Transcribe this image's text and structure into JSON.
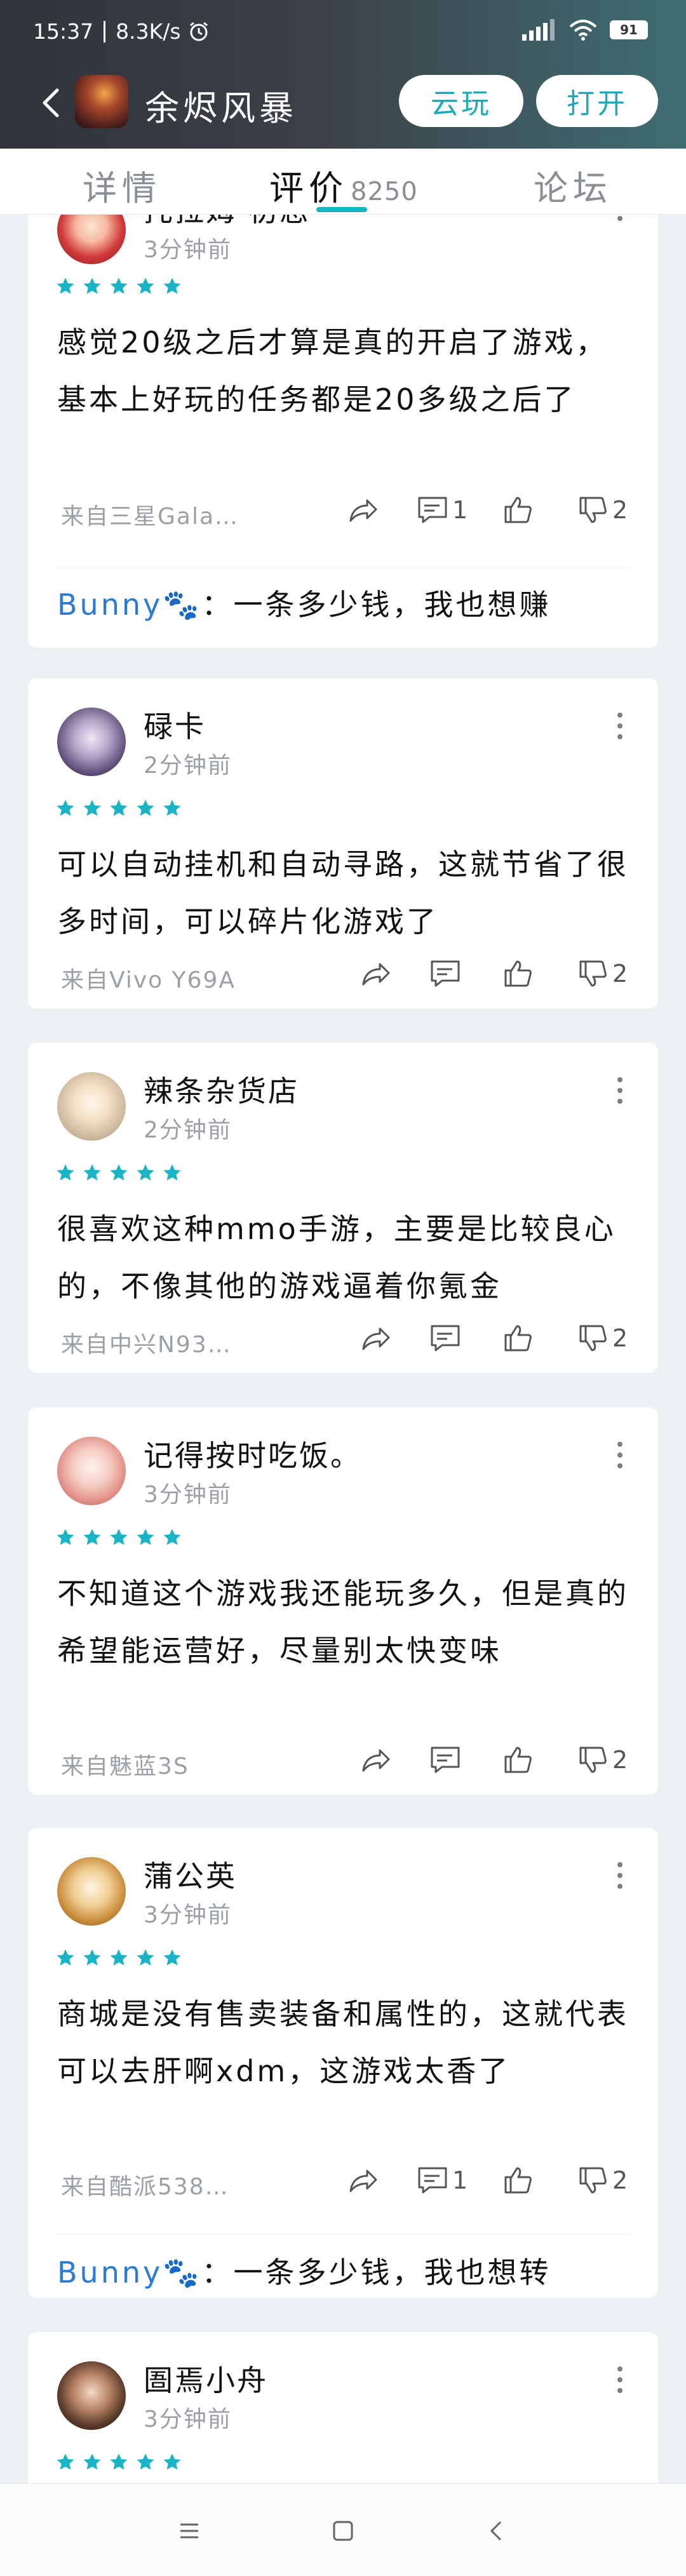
{
  "status_bar": {
    "time": "15:37",
    "net_speed": "8.3K/s",
    "battery": "91"
  },
  "header": {
    "app_title": "余烬风暴",
    "cloud_play_label": "云玩",
    "open_label": "打开"
  },
  "tabs": {
    "detail": "详情",
    "review": "评价",
    "review_count": "8250",
    "forum": "论坛"
  },
  "colors": {
    "accent": "#19b3c4",
    "header_dark": "#2f343b",
    "header_teal": "#3f6d74"
  },
  "reviews": [
    {
      "name": "托拉姆 初恋",
      "time": "3分钟前",
      "rating": 5,
      "text": "感觉20级之后才算是真的开启了游戏，基本上好玩的任务都是20多级之后了",
      "device": "来自三星Gala…",
      "comments": "1",
      "likes": "",
      "dislikes": "2",
      "reply_user": "Bunny🐾",
      "reply_text": "：一条多少钱，我也想赚"
    },
    {
      "name": "碌卡",
      "time": "2分钟前",
      "rating": 5,
      "text": "可以自动挂机和自动寻路，这就节省了很多时间，可以碎片化游戏了",
      "device": "来自Vivo Y69A",
      "comments": "",
      "likes": "",
      "dislikes": "2"
    },
    {
      "name": "辣条杂货店",
      "time": "2分钟前",
      "rating": 5,
      "text": "很喜欢这种mmo手游，主要是比较良心的，不像其他的游戏逼着你氪金",
      "device": "来自中兴N93…",
      "comments": "",
      "likes": "",
      "dislikes": "2"
    },
    {
      "name": "记得按时吃饭。",
      "time": "3分钟前",
      "rating": 5,
      "text": "不知道这个游戏我还能玩多久，但是真的希望能运营好，尽量别太快变味",
      "device": "来自魅蓝3S",
      "comments": "",
      "likes": "",
      "dislikes": "2"
    },
    {
      "name": "蒲公英",
      "time": "3分钟前",
      "rating": 5,
      "text": "商城是没有售卖装备和属性的，这就代表可以去肝啊xdm，这游戏太香了",
      "device": "来自酷派538…",
      "comments": "1",
      "likes": "",
      "dislikes": "2",
      "reply_user": "Bunny🐾",
      "reply_text": "：一条多少钱，我也想转"
    },
    {
      "name": "圄焉小舟",
      "time": "3分钟前",
      "rating": 5
    }
  ]
}
